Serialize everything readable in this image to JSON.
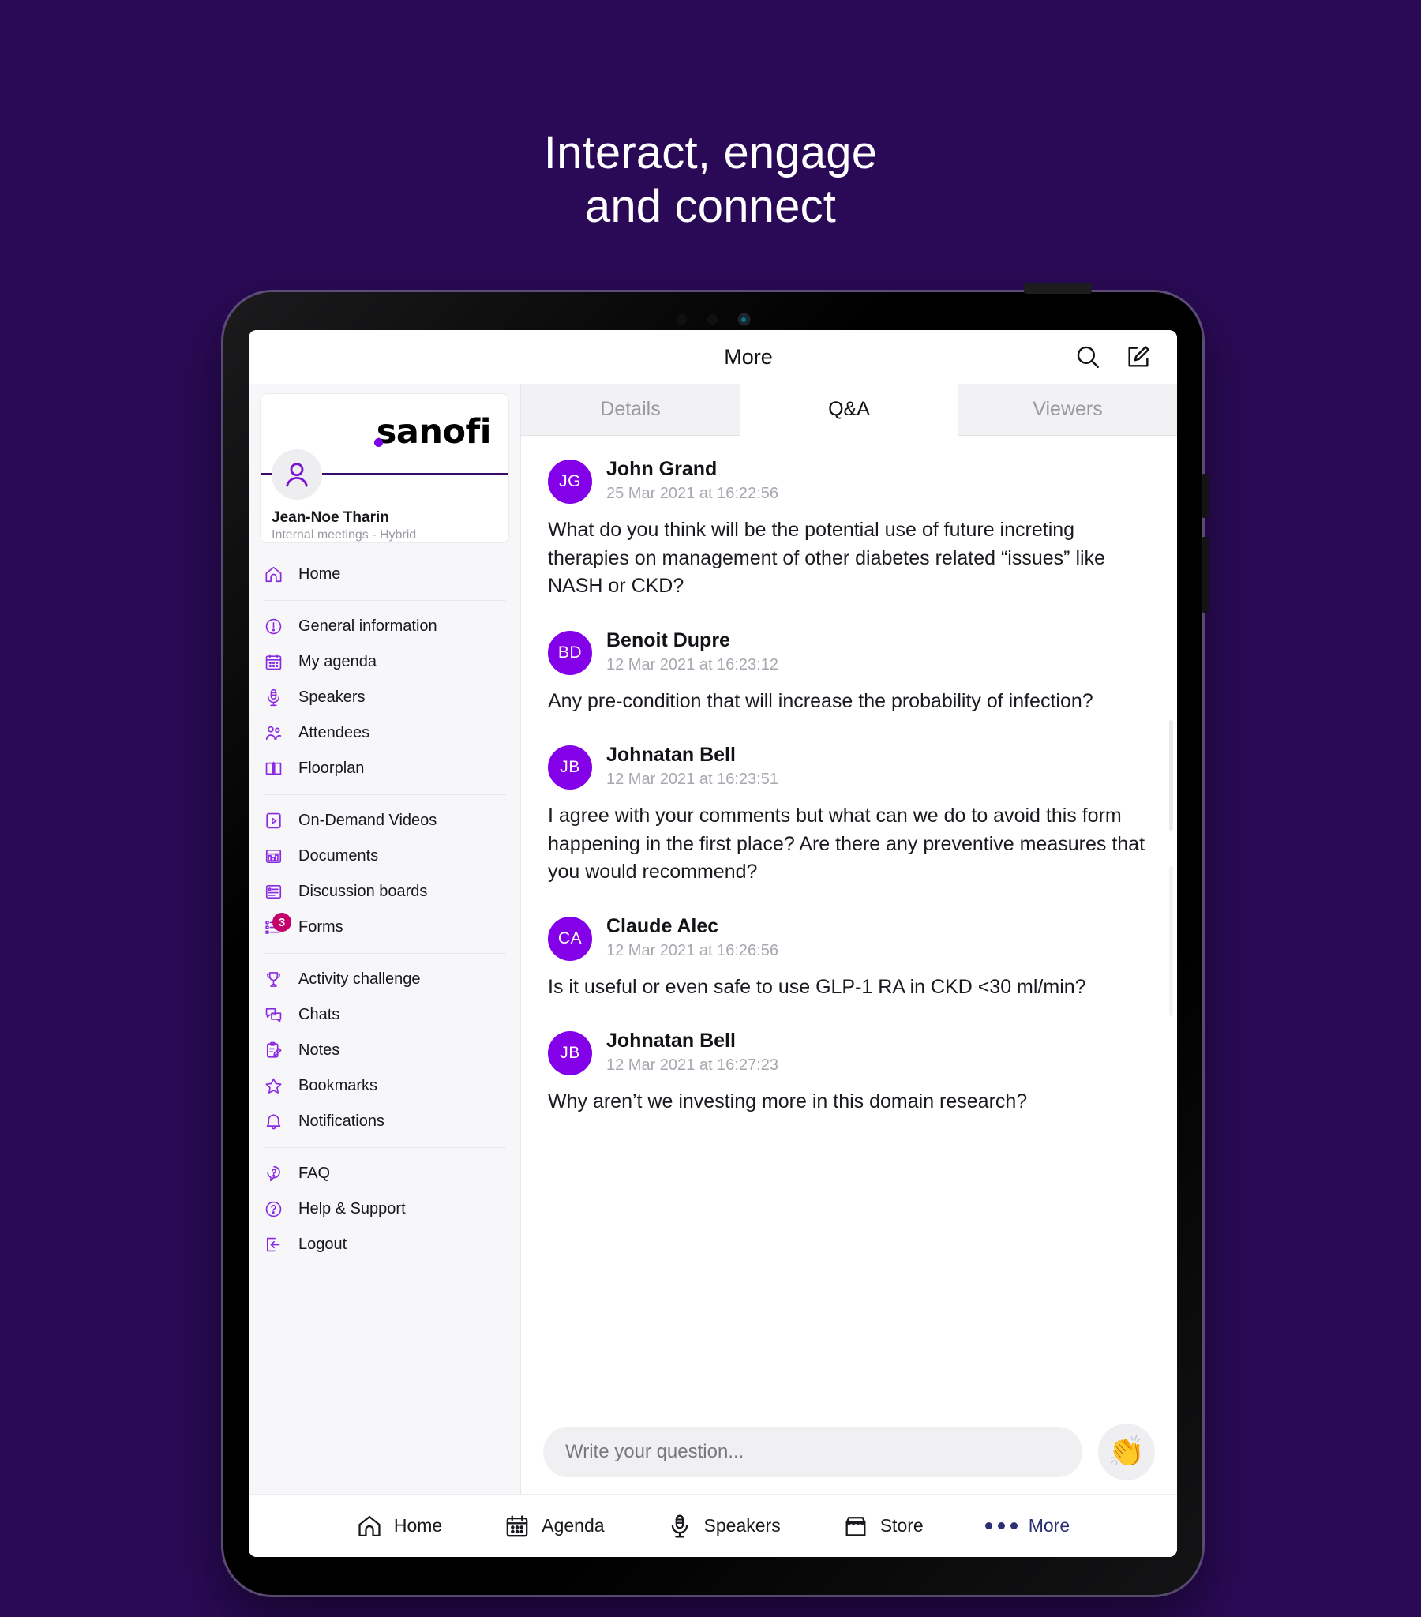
{
  "headline": {
    "line1": "Interact, engage",
    "line2": "and connect"
  },
  "topbar": {
    "title": "More",
    "search_icon": "search-icon",
    "compose_icon": "compose-icon"
  },
  "sidebar": {
    "brand": "sanofi",
    "profile": {
      "name": "Jean-Noe Tharin",
      "subtitle": "Internal meetings - Hybrid",
      "avatar_icon": "person-icon"
    },
    "groups": [
      {
        "items": [
          {
            "label": "Home",
            "icon": "home-icon"
          }
        ]
      },
      {
        "items": [
          {
            "label": "General information",
            "icon": "info-circle-icon"
          },
          {
            "label": "My agenda",
            "icon": "calendar-icon"
          },
          {
            "label": "Speakers",
            "icon": "microphone-icon"
          },
          {
            "label": "Attendees",
            "icon": "people-icon"
          },
          {
            "label": "Floorplan",
            "icon": "floorplan-icon"
          }
        ]
      },
      {
        "items": [
          {
            "label": "On-Demand Videos",
            "icon": "video-icon"
          },
          {
            "label": "Documents",
            "icon": "documents-icon"
          },
          {
            "label": "Discussion boards",
            "icon": "discussion-icon"
          },
          {
            "label": "Forms",
            "icon": "forms-icon",
            "badge": "3"
          }
        ]
      },
      {
        "items": [
          {
            "label": "Activity challenge",
            "icon": "trophy-icon"
          },
          {
            "label": "Chats",
            "icon": "chat-icon"
          },
          {
            "label": "Notes",
            "icon": "notes-icon"
          },
          {
            "label": "Bookmarks",
            "icon": "star-icon"
          },
          {
            "label": "Notifications",
            "icon": "bell-icon"
          }
        ]
      },
      {
        "items": [
          {
            "label": "FAQ",
            "icon": "faq-icon"
          },
          {
            "label": "Help & Support",
            "icon": "help-circle-icon"
          },
          {
            "label": "Logout",
            "icon": "logout-icon"
          }
        ]
      }
    ]
  },
  "main": {
    "tabs": [
      {
        "label": "Details",
        "active": false
      },
      {
        "label": "Q&A",
        "active": true
      },
      {
        "label": "Viewers",
        "active": false
      }
    ],
    "questions": [
      {
        "initials": "JG",
        "name": "John Grand",
        "time": "25 Mar 2021 at 16:22:56",
        "text": "What do you think will be the potential use of future increting therapies on management of other diabetes related “issues” like NASH or CKD?"
      },
      {
        "initials": "BD",
        "name": "Benoit Dupre",
        "time": "12 Mar 2021 at 16:23:12",
        "text": "Any pre-condition that will increase the probability of infection?"
      },
      {
        "initials": "JB",
        "name": "Johnatan Bell",
        "time": "12 Mar 2021 at 16:23:51",
        "text": "I agree with your comments but what can we do to avoid this form happening in the first place? Are there any preventive measures that you would recommend?"
      },
      {
        "initials": "CA",
        "name": "Claude Alec",
        "time": "12 Mar 2021 at 16:26:56",
        "text": "Is it useful or even safe to use GLP-1 RA in CKD <30 ml/min?"
      },
      {
        "initials": "JB",
        "name": "Johnatan Bell",
        "time": "12 Mar 2021 at 16:27:23",
        "text": "Why aren’t we investing more in this domain research?"
      }
    ],
    "composer": {
      "placeholder": "Write your question...",
      "clap_icon": "clapping-hands-icon",
      "clap_glyph": "👏"
    }
  },
  "bottom_nav": [
    {
      "label": "Home",
      "icon": "home-icon",
      "active": false
    },
    {
      "label": "Agenda",
      "icon": "calendar-icon",
      "active": false
    },
    {
      "label": "Speakers",
      "icon": "microphone-icon",
      "active": false
    },
    {
      "label": "Store",
      "icon": "store-icon",
      "active": false
    },
    {
      "label": "More",
      "icon": "ellipsis-icon",
      "active": true
    }
  ],
  "colors": {
    "background": "#2a0a56",
    "accent_purple": "#8400e8",
    "badge_magenta": "#c4006b",
    "active_nav": "#2c2f76"
  }
}
